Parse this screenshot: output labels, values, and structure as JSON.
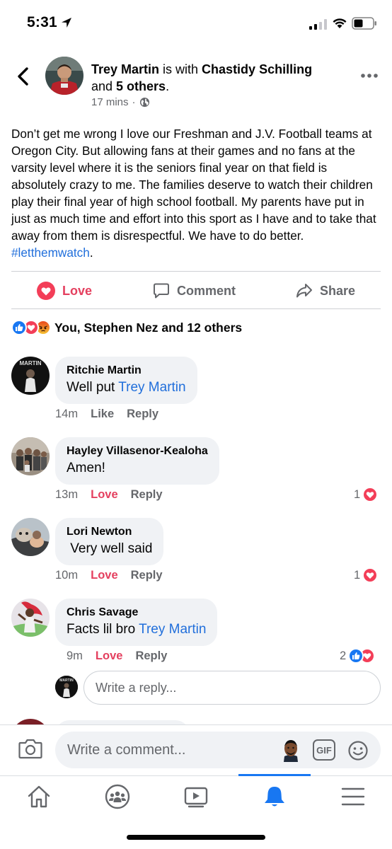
{
  "status_bar": {
    "time": "5:31"
  },
  "post": {
    "author": "Trey Martin",
    "with_word": " is with ",
    "tagged": "Chastidy Schilling",
    "and_word": "and ",
    "others": "5 others",
    "period": ".",
    "time": "17 mins",
    "dot": "·",
    "body": "Don’t get me wrong I love our Freshman and J.V. Football teams at Oregon City. But allowing fans at their games and no fans at the varsity level where it is the seniors final year on that field is absolutely crazy to me. The families deserve to watch their children play their final year of high school football. My parents have put in just as much time and effort into this sport as I have and to take that away from them is disrespectful. We have to do better. ",
    "hashtag": "#letthemwatch",
    "end": "."
  },
  "actions": {
    "love": "Love",
    "comment": "Comment",
    "share": "Share"
  },
  "reactions_summary": "You, Stephen Nez and 12 others",
  "comments": [
    {
      "name": "Ritchie Martin",
      "text": "Well put ",
      "mention": "Trey Martin",
      "time": "14m",
      "like": "Like",
      "reply": "Reply"
    },
    {
      "name": "Hayley Villasenor-Kealoha",
      "text": "Amen!",
      "time": "13m",
      "like": "Love",
      "reply": "Reply",
      "react_count": "1"
    },
    {
      "name": "Lori Newton",
      "text": " Very well said",
      "time": "10m",
      "like": "Love",
      "reply": "Reply",
      "react_count": "1"
    },
    {
      "name": "Chris Savage",
      "text": "Facts lil bro ",
      "mention": "Trey Martin",
      "time": "9m",
      "like": "Love",
      "reply": "Reply",
      "react_count": "2"
    }
  ],
  "reply_placeholder": "Write a reply...",
  "composer": {
    "placeholder": "Write a comment...",
    "gif": "GIF"
  },
  "colors": {
    "link": "#216fdb",
    "love": "#e4405f",
    "like_blue": "#1877f2",
    "muted": "#65676b"
  }
}
